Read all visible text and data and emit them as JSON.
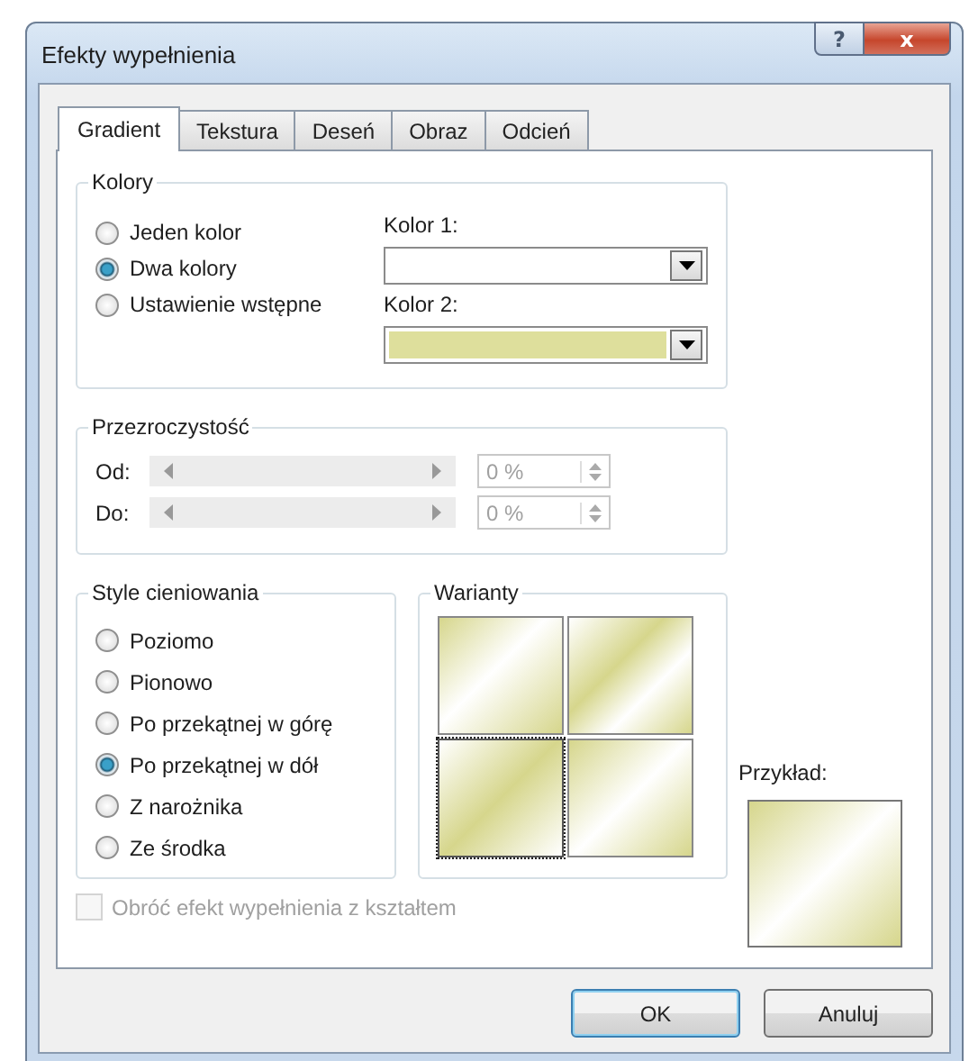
{
  "window": {
    "title": "Efekty wypełnienia",
    "help": "?",
    "close": "x"
  },
  "tabs": [
    {
      "label": "Gradient",
      "selected": true
    },
    {
      "label": "Tekstura",
      "selected": false
    },
    {
      "label": "Deseń",
      "selected": false
    },
    {
      "label": "Obraz",
      "selected": false
    },
    {
      "label": "Odcień",
      "selected": false
    }
  ],
  "colors": {
    "title": "Kolory",
    "options": [
      {
        "label": "Jeden kolor",
        "selected": false
      },
      {
        "label": "Dwa kolory",
        "selected": true
      },
      {
        "label": "Ustawienie wstępne",
        "selected": false
      }
    ],
    "pickers": [
      {
        "label": "Kolor 1:",
        "color": "#ffffff"
      },
      {
        "label": "Kolor 2:",
        "color": "#dedf9c"
      }
    ]
  },
  "transparency": {
    "title": "Przezroczystość",
    "rows": [
      {
        "label": "Od:",
        "value": "0 %",
        "disabled": true
      },
      {
        "label": "Do:",
        "value": "0 %",
        "disabled": true
      }
    ]
  },
  "shading": {
    "title": "Style cieniowania",
    "options": [
      {
        "label": "Poziomo",
        "selected": false
      },
      {
        "label": "Pionowo",
        "selected": false
      },
      {
        "label": "Po przekątnej w górę",
        "selected": false
      },
      {
        "label": "Po przekątnej w dół",
        "selected": true
      },
      {
        "label": "Z narożnika",
        "selected": false
      },
      {
        "label": "Ze środka",
        "selected": false
      }
    ]
  },
  "variants": {
    "title": "Warianty",
    "tiles": [
      {
        "selected": false
      },
      {
        "selected": false
      },
      {
        "selected": true
      },
      {
        "selected": false
      }
    ]
  },
  "preview": {
    "label": "Przykład:"
  },
  "rotate": {
    "label": "Obróć efekt wypełnienia z kształtem",
    "checked": false,
    "disabled": true
  },
  "buttons": [
    {
      "label": "OK",
      "default": true
    },
    {
      "label": "Anuluj",
      "default": false
    }
  ]
}
